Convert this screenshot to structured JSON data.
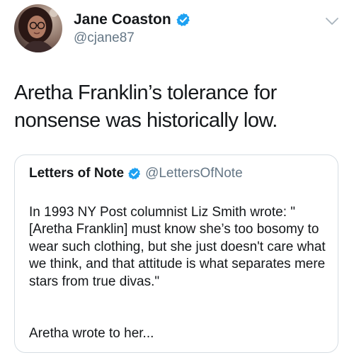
{
  "author": {
    "display_name": "Jane Coaston",
    "handle": "@cjane87",
    "verified_icon": "verified-badge-icon",
    "avatar": "avatar"
  },
  "menu_icon": "chevron-down-icon",
  "tweet": {
    "text": "Aretha Franklin’s tolerance for\nnonsense was historically low."
  },
  "quoted_tweet": {
    "display_name": "Letters of Note",
    "handle": "@LettersOfNote",
    "verified_icon": "verified-badge-icon",
    "paragraph_1": "In 1993 NY Post columnist Liz Smith wrote: \"[Aretha Franklin] must know she’s too bosomy to wear such clothing, but she just doesn't care what we think, and that attitude is what separates mere stars from true divas.\"",
    "paragraph_2": "Aretha wrote to her..."
  },
  "colors": {
    "text": "#14171a",
    "secondary": "#657786",
    "verified_blue": "#1da1f2",
    "border": "#d6dde3"
  }
}
